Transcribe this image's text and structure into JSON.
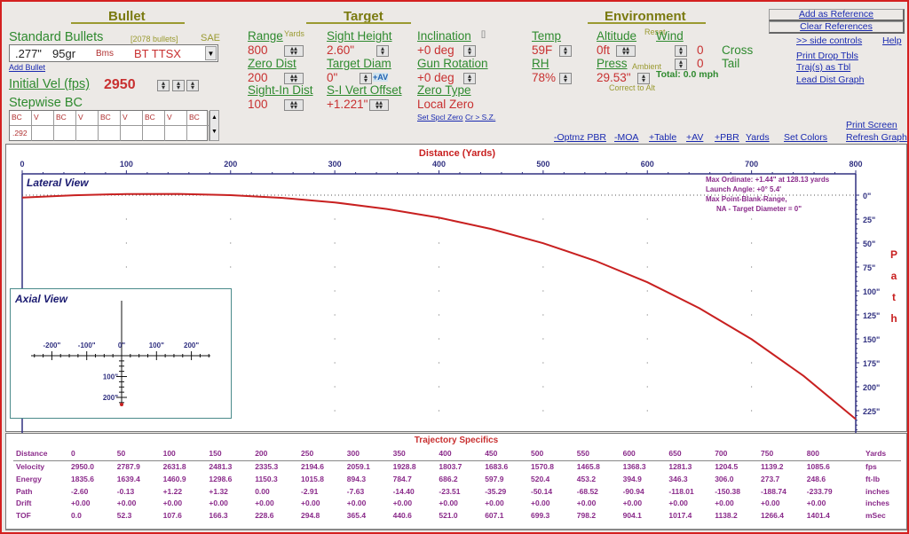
{
  "bullet": {
    "title": "Bullet",
    "standard_label": "Standard Bullets",
    "count": "[2078 bullets]",
    "units": "SAE",
    "selected": {
      "caliber": ".277\"",
      "weight": "95gr",
      "maker": "Bms",
      "name": "BT TTSX"
    },
    "add_bullet": "Add Bullet",
    "initial_vel_label": "Initial Vel (fps)",
    "initial_vel": "2950",
    "stepwise_label": "Stepwise BC",
    "bc_headers": [
      "BC",
      "V",
      "BC",
      "V",
      "BC",
      "V",
      "BC",
      "V",
      "BC"
    ],
    "bc_values": [
      ".292",
      "",
      "",
      "",
      "",
      "",
      "",
      "",
      ""
    ]
  },
  "target": {
    "title": "Target",
    "range_label": "Range",
    "range_unit": "Yards",
    "range": "800",
    "zero_dist_label": "Zero Dist",
    "zero_dist": "200",
    "sight_in_label": "Sight-In Dist",
    "sight_in": "100",
    "sight_height_label": "Sight Height",
    "sight_height": "2.60\"",
    "target_diam_label": "Target Diam",
    "target_diam": "0\"",
    "av_label": "+AV",
    "si_vert_label": "S-I Vert Offset",
    "si_vert": "+1.221\"",
    "inclination_label": "Inclination",
    "inclination_bracket": "[]",
    "inclination": "+0 deg",
    "gun_rotation_label": "Gun Rotation",
    "gun_rotation": "+0 deg",
    "zero_type_label": "Zero Type",
    "zero_type": "Local Zero",
    "set_spcl_zero": "Set Spcl Zero",
    "cr_sz": "Cr > S.Z."
  },
  "environment": {
    "title": "Environment",
    "temp_label": "Temp",
    "temp": "59F",
    "rh_label": "RH",
    "rh": "78%",
    "altitude_label": "Altitude",
    "reset": "Reset",
    "altitude": "0ft",
    "press_label": "Press",
    "ambient": "Ambient",
    "press": "29.53\"",
    "correct_alt": "Correct to Alt",
    "wind_label": "Wind",
    "cross_val": "0",
    "cross_label": "Cross",
    "tail_val": "0",
    "tail_label": "Tail",
    "total": "Total:  0.0 mph"
  },
  "side": {
    "add_ref": "Add as Reference",
    "clear_ref": "Clear References",
    "side_controls": ">>  side controls",
    "help": "Help",
    "print_drop": "Print Drop Tbls",
    "traj_tbl": "Traj(s) as Tbl",
    "lead_dist": "Lead Dist Graph",
    "print_screen": "Print Screen",
    "refresh": "Refresh Graph"
  },
  "toolbar": [
    "-Optmz PBR",
    "-MOA",
    "+Table",
    "+AV",
    "+PBR",
    "Yards",
    "Set Colors"
  ],
  "graph": {
    "x_title": "Distance  (Yards)",
    "x_ticks": [
      "0",
      "100",
      "200",
      "300",
      "400",
      "500",
      "600",
      "700",
      "800"
    ],
    "y_ticks": [
      "0\"",
      "25\"",
      "50\"",
      "75\"",
      "100\"",
      "125\"",
      "150\"",
      "175\"",
      "200\"",
      "225\""
    ],
    "y_title": [
      "P",
      "a",
      "t",
      "h"
    ],
    "lateral_label": "Lateral View",
    "axial_label": "Axial View",
    "info": [
      "Max Ordinate: +1.44\" at 128.13 yards",
      "Launch Angle:  +0° 5.4'",
      "Max Point-Blank-Range,",
      "NA - Target Diameter = 0\""
    ],
    "axial_x_ticks": [
      "-200\"",
      "-100\"",
      "0\"",
      "100\"",
      "200\""
    ],
    "axial_y_ticks": [
      "100\"",
      "200\""
    ],
    "curve_color": "#c82020",
    "axis_color": "#303080"
  },
  "table": {
    "title": "Trajectory Specifics",
    "rows": [
      {
        "label": "Distance",
        "unit": "Yards",
        "values": [
          "0",
          "50",
          "100",
          "150",
          "200",
          "250",
          "300",
          "350",
          "400",
          "450",
          "500",
          "550",
          "600",
          "650",
          "700",
          "750",
          "800"
        ]
      },
      {
        "label": "Velocity",
        "unit": "fps",
        "values": [
          "2950.0",
          "2787.9",
          "2631.8",
          "2481.3",
          "2335.3",
          "2194.6",
          "2059.1",
          "1928.8",
          "1803.7",
          "1683.6",
          "1570.8",
          "1465.8",
          "1368.3",
          "1281.3",
          "1204.5",
          "1139.2",
          "1085.6"
        ]
      },
      {
        "label": "Energy",
        "unit": "ft-lb",
        "values": [
          "1835.6",
          "1639.4",
          "1460.9",
          "1298.6",
          "1150.3",
          "1015.8",
          "894.3",
          "784.7",
          "686.2",
          "597.9",
          "520.4",
          "453.2",
          "394.9",
          "346.3",
          "306.0",
          "273.7",
          "248.6"
        ]
      },
      {
        "label": "Path",
        "unit": "inches",
        "values": [
          "-2.60",
          "-0.13",
          "+1.22",
          "+1.32",
          "0.00",
          "-2.91",
          "-7.63",
          "-14.40",
          "-23.51",
          "-35.29",
          "-50.14",
          "-68.52",
          "-90.94",
          "-118.01",
          "-150.38",
          "-188.74",
          "-233.79"
        ]
      },
      {
        "label": "Drift",
        "unit": "inches",
        "values": [
          "+0.00",
          "+0.00",
          "+0.00",
          "+0.00",
          "+0.00",
          "+0.00",
          "+0.00",
          "+0.00",
          "+0.00",
          "+0.00",
          "+0.00",
          "+0.00",
          "+0.00",
          "+0.00",
          "+0.00",
          "+0.00",
          "+0.00"
        ]
      },
      {
        "label": "TOF",
        "unit": "mSec",
        "values": [
          "0.0",
          "52.3",
          "107.6",
          "166.3",
          "228.6",
          "294.8",
          "365.4",
          "440.6",
          "521.0",
          "607.1",
          "699.3",
          "798.2",
          "904.1",
          "1017.4",
          "1138.2",
          "1266.4",
          "1401.4"
        ]
      }
    ]
  }
}
